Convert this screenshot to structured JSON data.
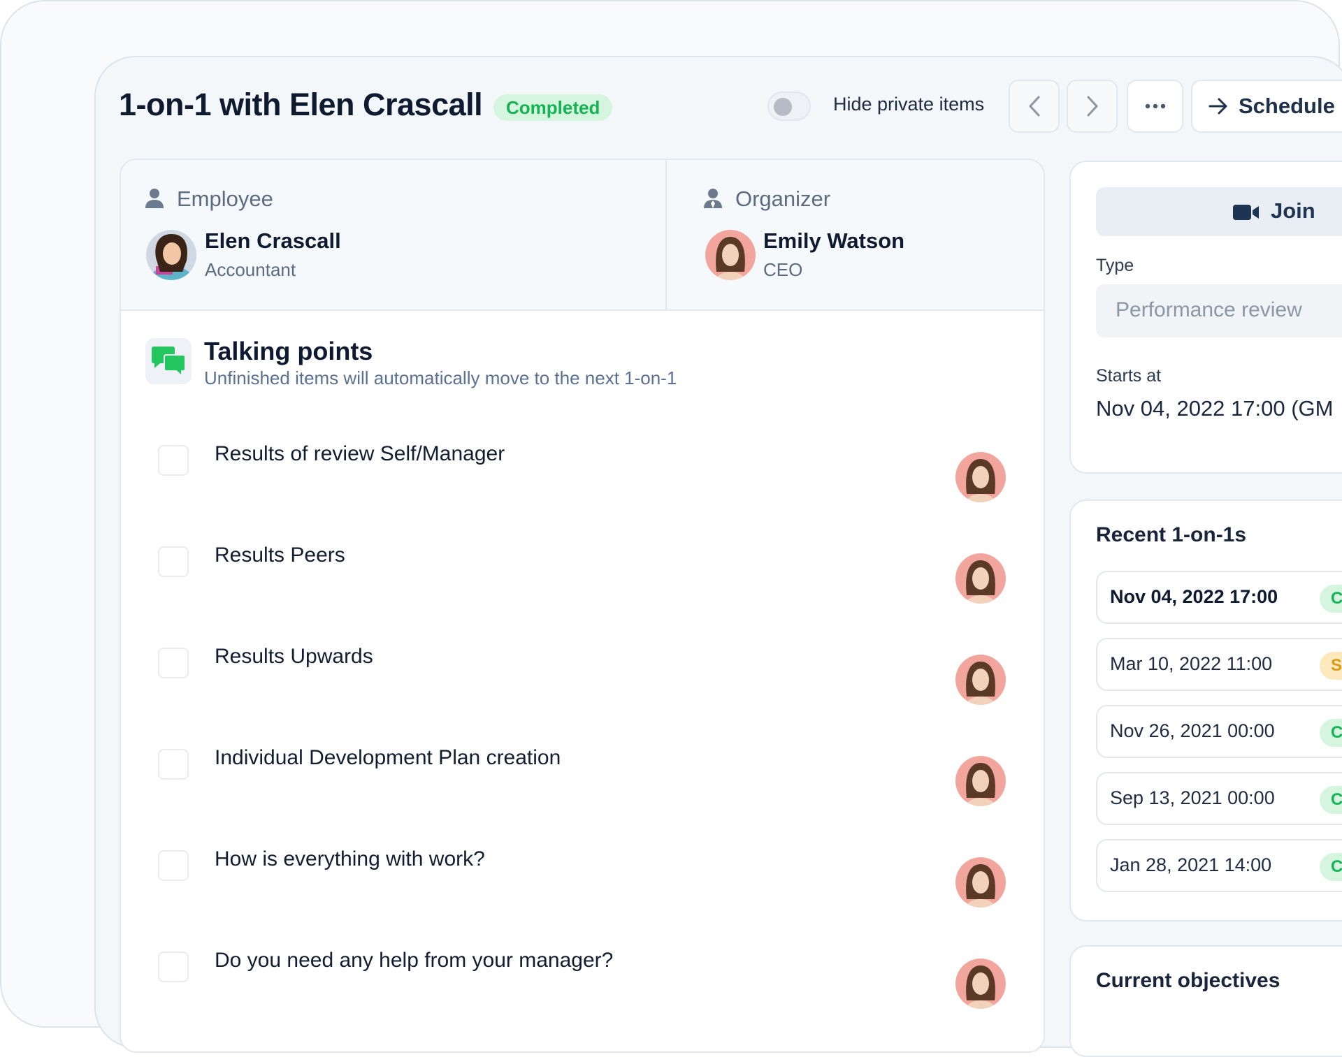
{
  "header": {
    "title": "1-on-1 with Elen Crascall",
    "status": "Completed",
    "hide_private_label": "Hide private items",
    "schedule_label": "Schedule"
  },
  "employee": {
    "role_label": "Employee",
    "name": "Elen Crascall",
    "title": "Accountant"
  },
  "organizer": {
    "role_label": "Organizer",
    "name": "Emily Watson",
    "title": "CEO"
  },
  "talking_points": {
    "title": "Talking points",
    "subtitle": "Unfinished items will automatically move to the next 1-on-1",
    "items": [
      {
        "text": "Results of review Self/Manager"
      },
      {
        "text": "Results Peers"
      },
      {
        "text": "Results Upwards"
      },
      {
        "text": "Individual Development Plan creation"
      },
      {
        "text": "How is everything with work?"
      },
      {
        "text": "Do you need any help from your manager?"
      }
    ]
  },
  "meeting": {
    "join_label": "Join",
    "type_label": "Type",
    "type_value": "Performance review",
    "starts_label": "Starts at",
    "starts_value": "Nov 04, 2022 17:00 (GM"
  },
  "recent": {
    "title": "Recent 1-on-1s",
    "items": [
      {
        "date": "Nov 04, 2022 17:00",
        "status": "C"
      },
      {
        "date": "Mar 10, 2022 11:00",
        "status": "S"
      },
      {
        "date": "Nov 26, 2021 00:00",
        "status": "C"
      },
      {
        "date": "Sep 13, 2021 00:00",
        "status": "C"
      },
      {
        "date": "Jan 28, 2021 14:00",
        "status": "C"
      }
    ]
  },
  "objectives": {
    "title": "Current objectives"
  },
  "colors": {
    "success": "#16b254",
    "success_bg": "#d6f5df",
    "warning": "#d99a14",
    "warning_bg": "#fde9bd",
    "accent_icon": "#22c55e"
  }
}
